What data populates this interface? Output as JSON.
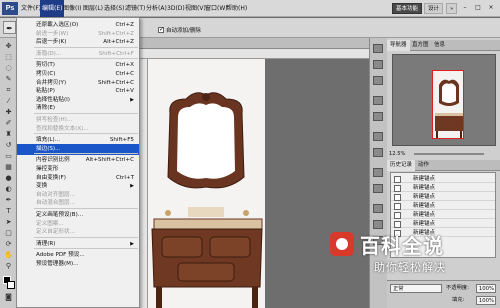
{
  "menubar": {
    "logo": "Ps",
    "items": [
      "文件(F)",
      "编辑(E)",
      "图像(I)",
      "图层(L)",
      "选择(S)",
      "滤镜(T)",
      "分析(A)",
      "3D(D)",
      "视图(V)",
      "窗口(W)",
      "帮助(H)"
    ],
    "zoom": "12.5",
    "workspace_buttons": [
      "基本功能",
      "设计"
    ],
    "more": "»",
    "window_controls": [
      "–",
      "□",
      "×"
    ]
  },
  "options": {
    "auto_add_delete_label": "自动添加/删除",
    "auto_add_delete_checked": true
  },
  "edit_menu": {
    "items": [
      {
        "label": "还原載入选区(O)",
        "shortcut": "Ctrl+Z",
        "disabled": false
      },
      {
        "label": "前进一步(W)",
        "shortcut": "Shift+Ctrl+Z",
        "disabled": true
      },
      {
        "label": "后退一步(K)",
        "shortcut": "Alt+Ctrl+Z",
        "disabled": false
      },
      {
        "sep": true
      },
      {
        "label": "渐隐(D)...",
        "shortcut": "Shift+Ctrl+F",
        "disabled": true
      },
      {
        "sep": true
      },
      {
        "label": "剪切(T)",
        "shortcut": "Ctrl+X",
        "disabled": false
      },
      {
        "label": "拷贝(C)",
        "shortcut": "Ctrl+C",
        "disabled": false
      },
      {
        "label": "合并拷贝(Y)",
        "shortcut": "Shift+Ctrl+C",
        "disabled": false
      },
      {
        "label": "粘贴(P)",
        "shortcut": "Ctrl+V",
        "disabled": false
      },
      {
        "label": "选择性粘贴(I)",
        "shortcut": "",
        "disabled": false,
        "submenu": true
      },
      {
        "label": "清除(E)",
        "shortcut": "",
        "disabled": false
      },
      {
        "sep": true
      },
      {
        "label": "拼写检查(H)...",
        "shortcut": "",
        "disabled": true
      },
      {
        "label": "查找和替换文本(X)...",
        "shortcut": "",
        "disabled": true
      },
      {
        "sep": true
      },
      {
        "label": "填充(L)...",
        "shortcut": "Shift+F5",
        "disabled": false
      },
      {
        "label": "描边(S)...",
        "shortcut": "",
        "disabled": false,
        "highlight": true
      },
      {
        "sep": true
      },
      {
        "label": "内容识别比例",
        "shortcut": "Alt+Shift+Ctrl+C",
        "disabled": false
      },
      {
        "label": "操控变形",
        "shortcut": "",
        "disabled": false
      },
      {
        "label": "自由变换(F)",
        "shortcut": "Ctrl+T",
        "disabled": false
      },
      {
        "label": "变换",
        "shortcut": "",
        "disabled": false,
        "submenu": true
      },
      {
        "label": "自动对齐图层...",
        "shortcut": "",
        "disabled": true
      },
      {
        "label": "自动混合图层...",
        "shortcut": "",
        "disabled": true
      },
      {
        "sep": true
      },
      {
        "label": "定义画笔预设(B)...",
        "shortcut": "",
        "disabled": false
      },
      {
        "label": "定义图案...",
        "shortcut": "",
        "disabled": true
      },
      {
        "label": "定义自定形状...",
        "shortcut": "",
        "disabled": true
      },
      {
        "sep": true
      },
      {
        "label": "清理(R)",
        "shortcut": "",
        "disabled": false,
        "submenu": true
      },
      {
        "sep": true
      },
      {
        "label": "Adobe PDF 预设...",
        "shortcut": "",
        "disabled": false
      },
      {
        "label": "预设管理器(M)...",
        "shortcut": "",
        "disabled": false
      }
    ]
  },
  "panels": {
    "top_tabs": [
      "导航器",
      "直方图",
      "信息"
    ],
    "nav_zoom": "12.5%",
    "history_tabs": [
      "历史记录",
      "动作"
    ],
    "history_items": [
      "新建锚点",
      "新建锚点",
      "新建锚点",
      "新建锚点",
      "新建锚点",
      "新建锚点",
      "新建锚点"
    ],
    "blend_mode": "正常",
    "opacity_label": "不透明度:",
    "opacity_value": "100%",
    "fill_label": "填充:",
    "fill_value": "100%"
  },
  "watermark": {
    "title": "百科全说",
    "subtitle": "助你轻松解决"
  }
}
